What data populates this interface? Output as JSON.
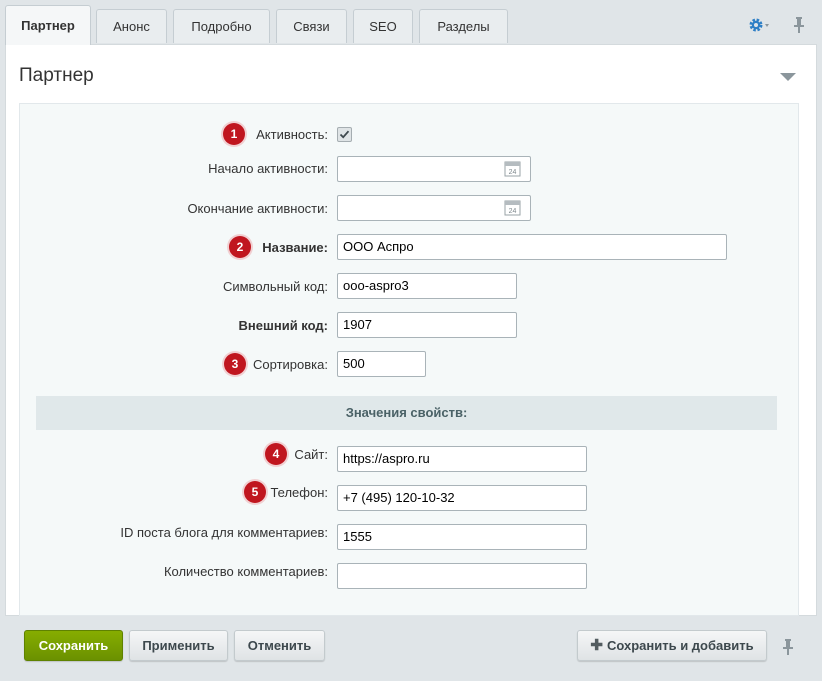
{
  "tabs": [
    {
      "label": "Партнер",
      "active": true
    },
    {
      "label": "Анонс"
    },
    {
      "label": "Подробно"
    },
    {
      "label": "Связи"
    },
    {
      "label": "SEO"
    },
    {
      "label": "Разделы"
    }
  ],
  "panel": {
    "title": "Партнер"
  },
  "form": {
    "active": {
      "label": "Активность:",
      "badge": "1",
      "checked": true
    },
    "start": {
      "label": "Начало активности:",
      "value": ""
    },
    "end": {
      "label": "Окончание активности:",
      "value": ""
    },
    "name": {
      "label": "Название:",
      "badge": "2",
      "value": "ООО Аспро"
    },
    "code": {
      "label": "Символьный код:",
      "value": "ooo-aspro3"
    },
    "ext_code": {
      "label": "Внешний код:",
      "value": "1907"
    },
    "sort": {
      "label": "Сортировка:",
      "badge": "3",
      "value": "500"
    },
    "props_header": "Значения свойств:",
    "site": {
      "label": "Сайт:",
      "badge": "4",
      "value": "https://aspro.ru"
    },
    "phone": {
      "label": "Телефон:",
      "badge": "5",
      "value": "+7 (495) 120-10-32"
    },
    "blog_id": {
      "label": "ID поста блога для комментариев:",
      "value": "1555"
    },
    "comments": {
      "label": "Количество комментариев:",
      "value": ""
    }
  },
  "buttons": {
    "save": "Сохранить",
    "apply": "Применить",
    "cancel": "Отменить",
    "save_add": "Сохранить и добавить"
  },
  "colors": {
    "accent_green": "#78a000",
    "badge_red": "#c0161f",
    "gear_blue": "#2e7fc6"
  }
}
